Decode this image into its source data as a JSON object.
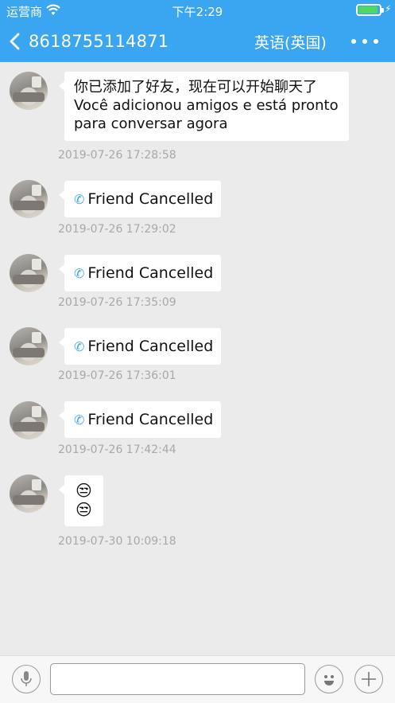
{
  "status": {
    "carrier": "运营商",
    "time": "下午2:29"
  },
  "header": {
    "contact": "8618755114871",
    "language": "英语(英国)"
  },
  "messages": [
    {
      "kind": "text",
      "text": "你已添加了好友，现在可以开始聊天了\nVocê adicionou amigos e está pronto\npara conversar agora",
      "time": "2019-07-26 17:28:58"
    },
    {
      "kind": "call",
      "text": "Friend Cancelled",
      "time": "2019-07-26 17:29:02"
    },
    {
      "kind": "call",
      "text": "Friend Cancelled",
      "time": "2019-07-26 17:35:09"
    },
    {
      "kind": "call",
      "text": "Friend Cancelled",
      "time": "2019-07-26 17:36:01"
    },
    {
      "kind": "call",
      "text": "Friend Cancelled",
      "time": "2019-07-26 17:42:44"
    },
    {
      "kind": "emoji",
      "text": "😒\n😒",
      "time": "2019-07-30 10:09:18"
    }
  ],
  "input": {
    "placeholder": "",
    "value": ""
  },
  "icons": {
    "phone": "phone-icon",
    "back": "chevron-left-icon",
    "more": "more-icon",
    "mic": "microphone-icon",
    "emoji": "smiley-icon",
    "add": "plus-icon"
  },
  "colors": {
    "accent": "#3aa5f0",
    "background": "#ebebeb"
  }
}
